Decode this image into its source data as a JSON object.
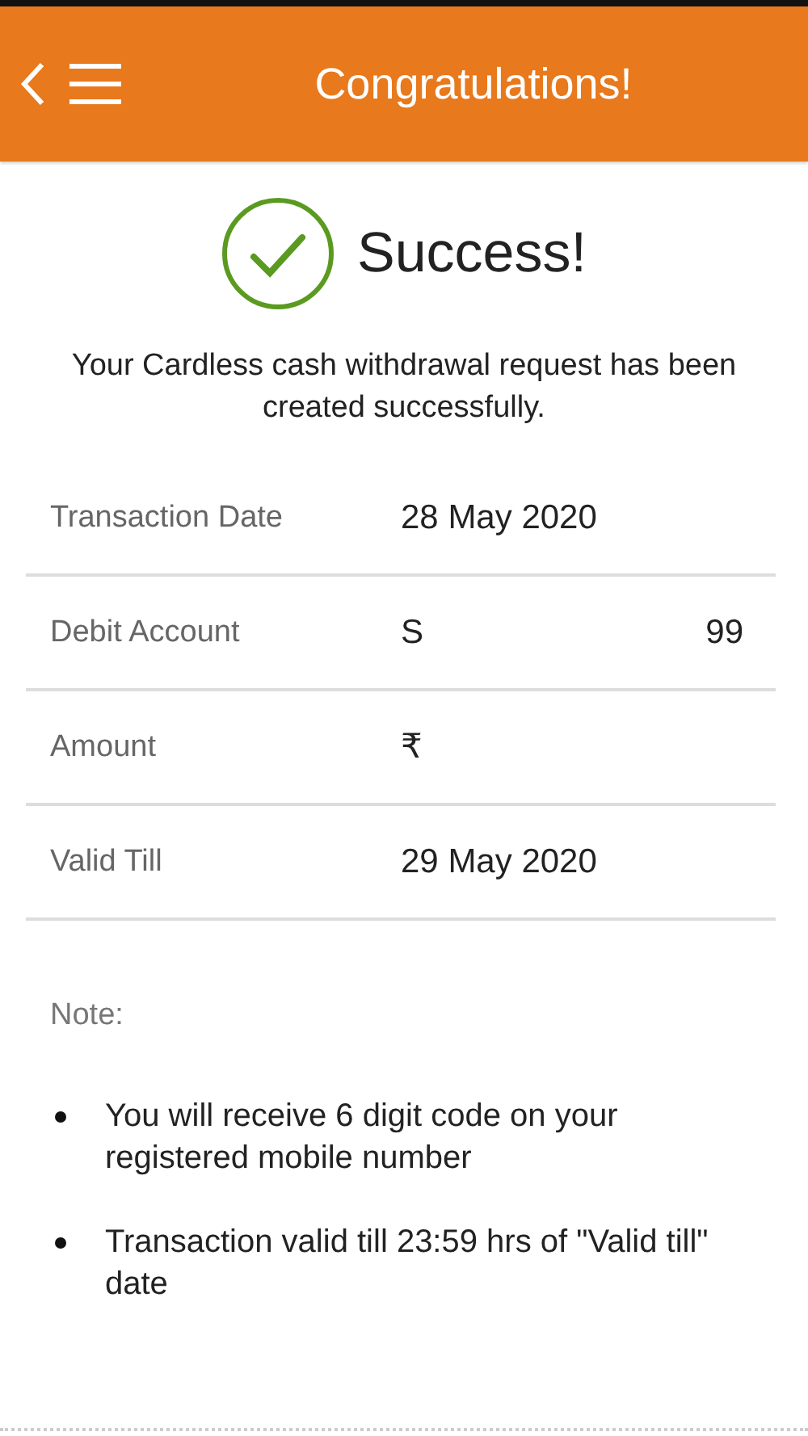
{
  "header": {
    "title": "Congratulations!"
  },
  "status": {
    "kind": "success",
    "title": "Success!"
  },
  "message": "Your Cardless cash withdrawal request has been created successfully.",
  "details": [
    {
      "label": "Transaction Date",
      "values": [
        "28 May 2020"
      ]
    },
    {
      "label": "Debit Account",
      "values": [
        "S",
        "99"
      ]
    },
    {
      "label": "Amount",
      "values": [
        "₹"
      ]
    },
    {
      "label": "Valid Till",
      "values": [
        "29 May 2020"
      ]
    }
  ],
  "note": {
    "title": "Note:",
    "items": [
      "You will receive 6 digit code on your registered mobile number",
      "Transaction valid till 23:59 hrs of \"Valid till\" date"
    ]
  }
}
